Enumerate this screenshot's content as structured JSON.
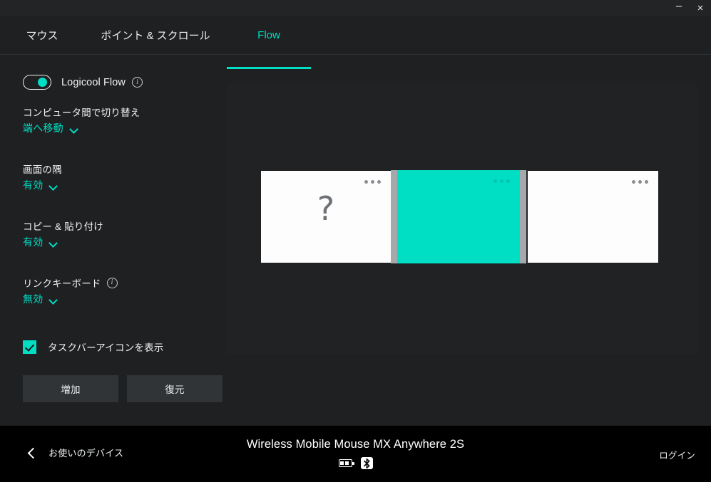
{
  "window": {
    "minimize_label": "–",
    "close_label": "×"
  },
  "tabs": [
    {
      "label": "マウス",
      "active": false
    },
    {
      "label": "ポイント & スクロール",
      "active": false
    },
    {
      "label": "Flow",
      "active": true
    }
  ],
  "sidebar": {
    "flow_toggle": {
      "label": "Logicool Flow",
      "state": "on",
      "info_glyph": "i"
    },
    "settings": [
      {
        "label": "コンピュータ間で切り替え",
        "value": "端へ移動",
        "has_info": false
      },
      {
        "label": "画面の隅",
        "value": "有効",
        "has_info": false
      },
      {
        "label": "コピー & 貼り付け",
        "value": "有効",
        "has_info": false
      },
      {
        "label": "リンクキーボード",
        "value": "無効",
        "has_info": true,
        "info_glyph": "i"
      }
    ],
    "taskbar_checkbox": {
      "label": "タスクバーアイコンを表示",
      "checked": true
    },
    "buttons": [
      {
        "label": "増加"
      },
      {
        "label": "復元"
      }
    ]
  },
  "preview": {
    "screens": [
      {
        "id": "screen-left",
        "state": "unknown",
        "glyph": "?",
        "active": false
      },
      {
        "id": "screen-mid",
        "state": "active",
        "glyph": "",
        "active": true
      },
      {
        "id": "screen-right",
        "state": "normal",
        "glyph": "",
        "active": false
      }
    ]
  },
  "bottombar": {
    "back_label": "お使いのデバイス",
    "device_name": "Wireless Mobile Mouse MX Anywhere 2S",
    "login_label": "ログイン",
    "status_icons": [
      "battery-icon",
      "bluetooth-icon"
    ]
  },
  "colors": {
    "accent": "#00dec4",
    "app_bg": "#1e2022",
    "panel_bg": "#202224",
    "bottom_bg": "#000000",
    "button_bg": "#313437"
  }
}
